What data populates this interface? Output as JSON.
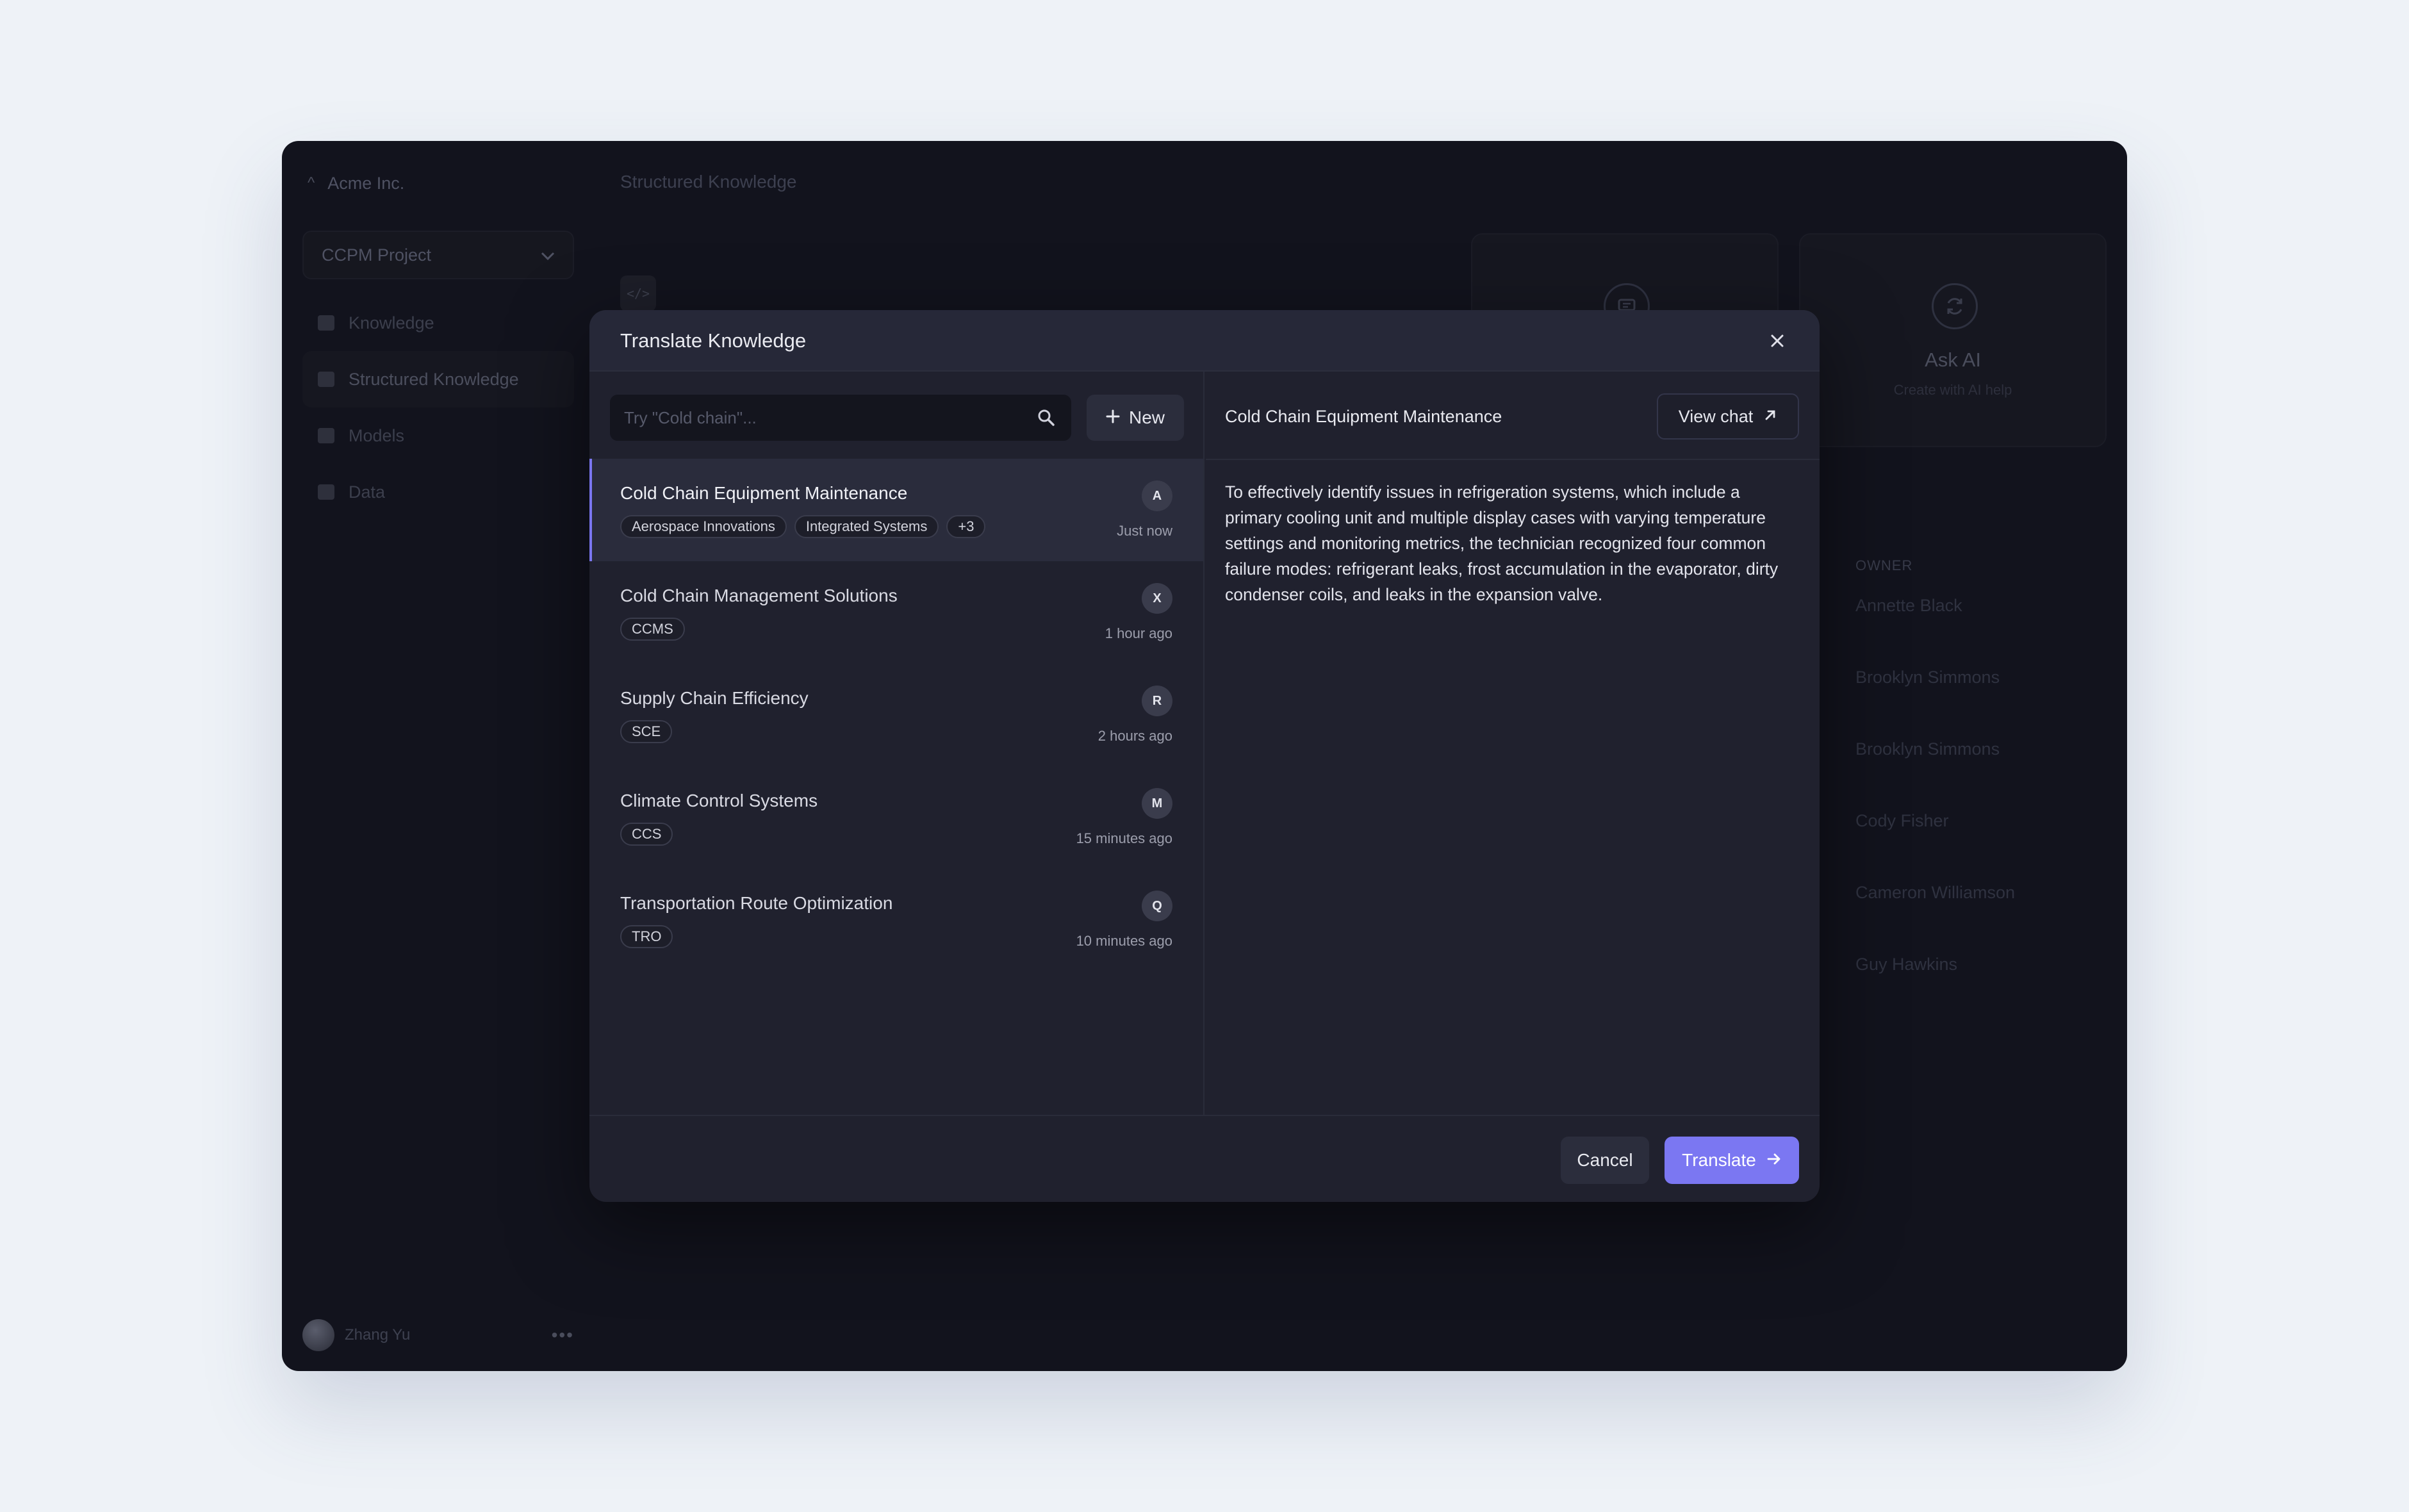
{
  "sidebar": {
    "org_name": "Acme Inc.",
    "project": "CCPM Project",
    "items": [
      {
        "label": "Knowledge"
      },
      {
        "label": "Structured Knowledge"
      },
      {
        "label": "Models"
      },
      {
        "label": "Data"
      }
    ],
    "user_name": "Zhang Yu"
  },
  "main": {
    "breadcrumb": "Structured Knowledge",
    "code_chip": "</>",
    "ask_card": {
      "title": "Ask AI",
      "subtitle": "Create with AI help"
    },
    "owner_header": "OWNER",
    "owners": [
      "Annette Black",
      "Brooklyn Simmons",
      "Brooklyn Simmons",
      "Cody Fisher",
      "Cameron Williamson",
      "Guy Hawkins"
    ]
  },
  "modal": {
    "title": "Translate Knowledge",
    "search_placeholder": "Try \"Cold chain\"...",
    "new_label": "New",
    "items": [
      {
        "title": "Cold Chain Equipment Maintenance",
        "tags": [
          "Aerospace Innovations",
          "Integrated Systems",
          "+3"
        ],
        "letter": "A",
        "time": "Just now"
      },
      {
        "title": "Cold Chain Management Solutions",
        "tags": [
          "CCMS"
        ],
        "letter": "X",
        "time": "1 hour ago"
      },
      {
        "title": "Supply Chain Efficiency",
        "tags": [
          "SCE"
        ],
        "letter": "R",
        "time": "2 hours ago"
      },
      {
        "title": "Climate Control Systems",
        "tags": [
          "CCS"
        ],
        "letter": "M",
        "time": "15 minutes ago"
      },
      {
        "title": "Transportation Route Optimization",
        "tags": [
          "TRO"
        ],
        "letter": "Q",
        "time": "10 minutes ago"
      }
    ],
    "detail": {
      "title": "Cold Chain Equipment Maintenance",
      "view_chat_label": "View chat",
      "body": "To effectively identify issues in refrigeration systems, which include a primary cooling unit and multiple display cases with varying temperature settings and monitoring metrics, the technician recognized four common failure modes: refrigerant leaks, frost accumulation in the evaporator, dirty condenser coils, and leaks in the expansion valve."
    },
    "cancel_label": "Cancel",
    "translate_label": "Translate"
  },
  "colors": {
    "accent": "#7b77f2",
    "modal_bg": "#20212e",
    "app_bg": "#12131d",
    "page_bg": "#eef2f7"
  }
}
